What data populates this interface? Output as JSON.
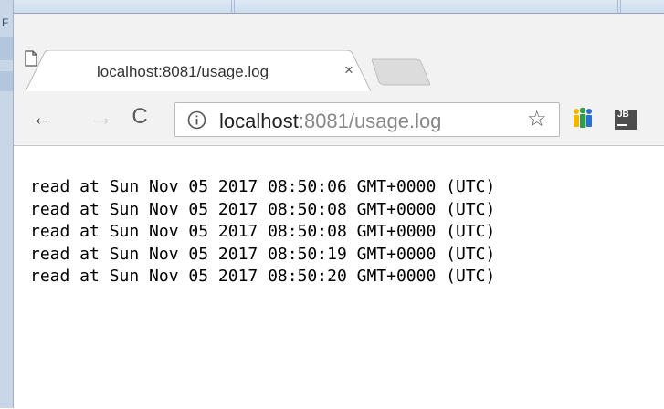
{
  "browser": {
    "tab": {
      "title": "localhost:8081/usage.log",
      "close_glyph": "×",
      "icon": "page-icon"
    },
    "toolbar": {
      "back_glyph": "←",
      "forward_glyph": "→",
      "reload_glyph": "C",
      "address": {
        "host": "localhost",
        "rest": ":8081/usage.log",
        "info_icon": "info-icon"
      },
      "bookmark_glyph": "☆",
      "extensions": [
        {
          "name": "people-extension-icon"
        },
        {
          "name": "jb-extension-icon",
          "label": "JB"
        }
      ]
    }
  },
  "background_window": {
    "fragment_text": "F"
  },
  "log_lines": [
    "read at Sun Nov 05 2017 08:50:06 GMT+0000 (UTC)",
    "read at Sun Nov 05 2017 08:50:08 GMT+0000 (UTC)",
    "read at Sun Nov 05 2017 08:50:08 GMT+0000 (UTC)",
    "read at Sun Nov 05 2017 08:50:19 GMT+0000 (UTC)",
    "read at Sun Nov 05 2017 08:50:20 GMT+0000 (UTC)"
  ],
  "colors": {
    "chrome_bg": "#f2f2f2",
    "url_host": "#222222",
    "url_rest": "#888888",
    "ext_yellow": "#f2b705",
    "ext_green": "#2e9e48",
    "ext_blue": "#2d6fd1"
  }
}
